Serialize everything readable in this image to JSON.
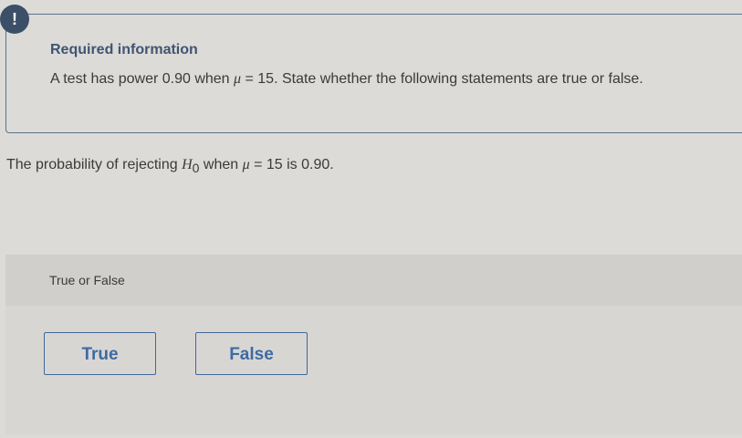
{
  "alert": {
    "icon": "exclamation-icon",
    "glyph": "!",
    "color": "#3b4f68"
  },
  "info": {
    "title": "Required information",
    "text_before_mu": "A test has power 0.90 when ",
    "mu_symbol": "μ",
    "text_after_mu": " = 15. State whether the following statements are true or false."
  },
  "question": {
    "text_before_h": "The probability of rejecting ",
    "h_symbol": "H",
    "h_sub": "0",
    "text_middle": " when ",
    "mu_symbol": "μ",
    "text_after_mu": " = 15 is 0.90."
  },
  "answer": {
    "label": "True or False",
    "options": [
      "True",
      "False"
    ],
    "accent_color": "#3e6aa3"
  }
}
